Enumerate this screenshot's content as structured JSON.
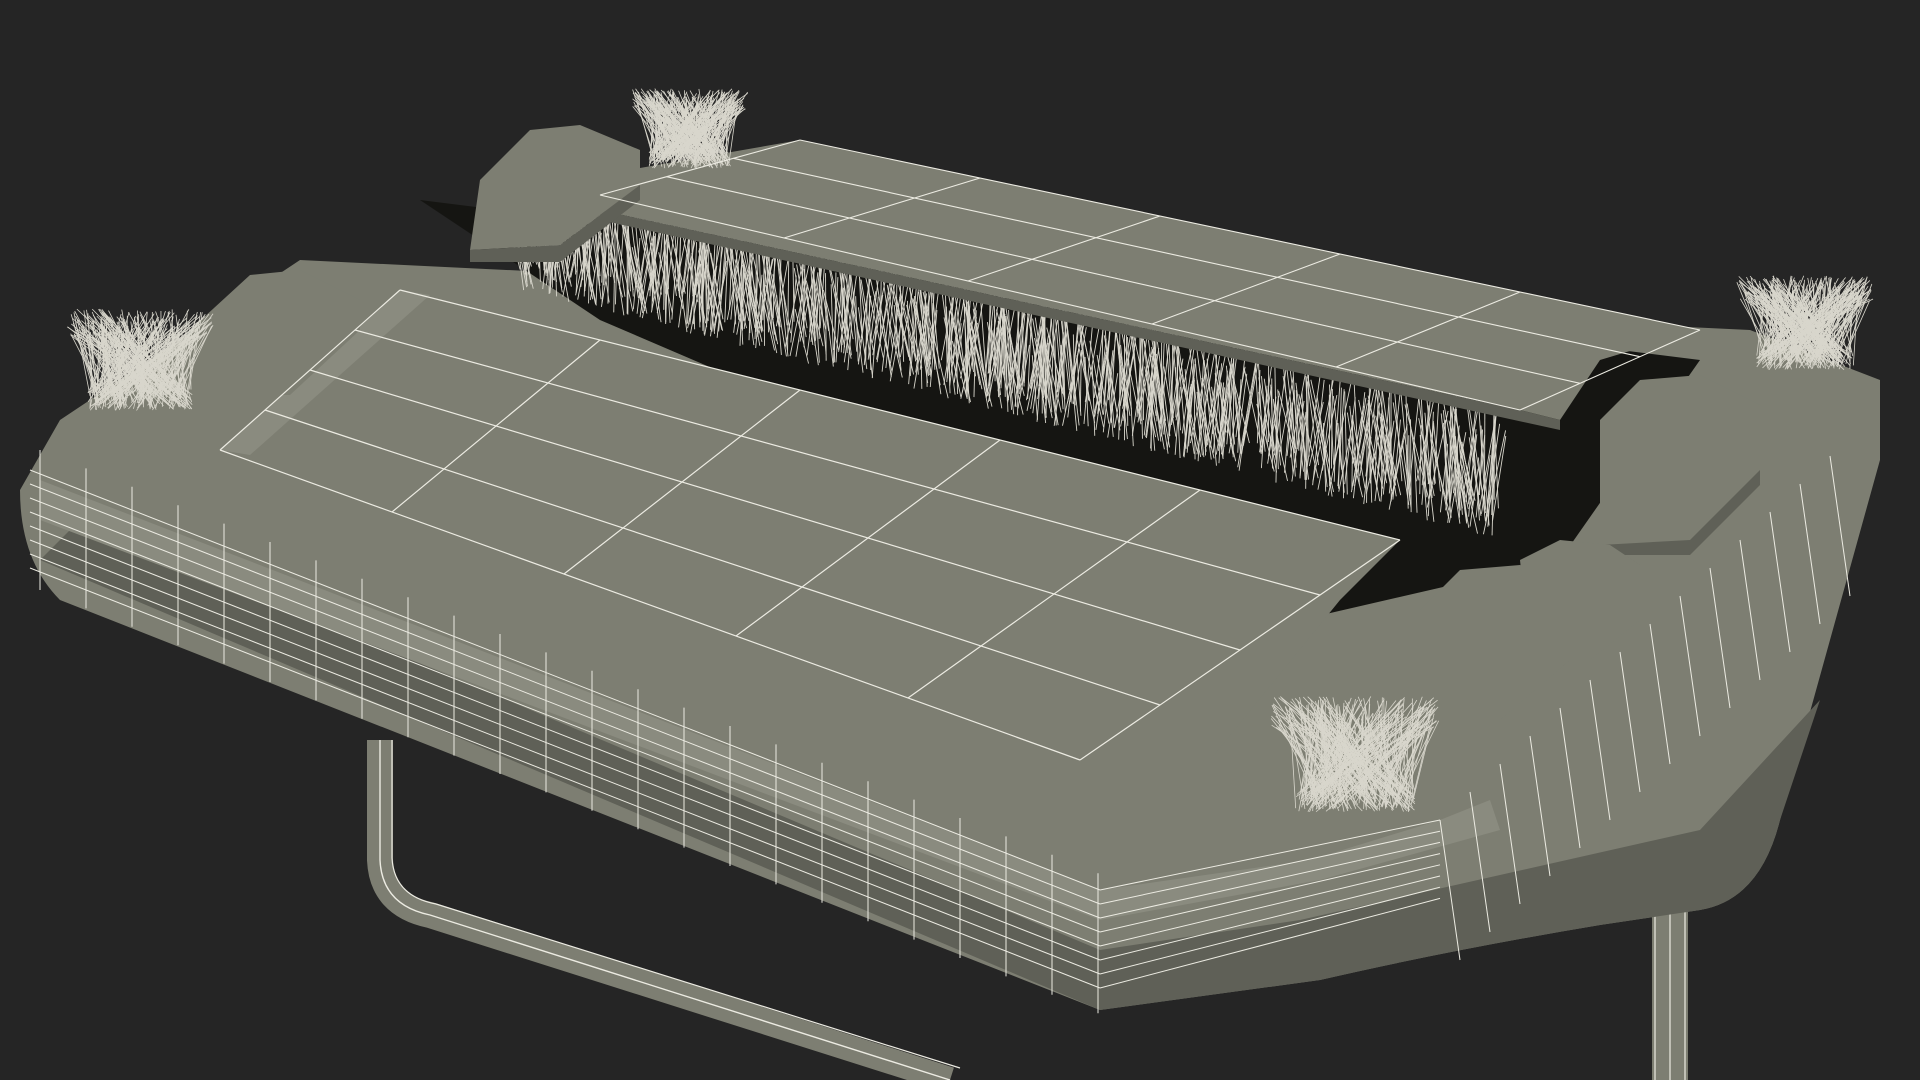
{
  "scene": {
    "background_color": "#252525",
    "model_color": "#7d7e72",
    "model_shadow_color": "#5f6057",
    "model_highlight_color": "#8a8b7f",
    "wire_color": "#ecebe2",
    "bristle_color": "#d8d6cc",
    "cavity_color": "#151512"
  }
}
